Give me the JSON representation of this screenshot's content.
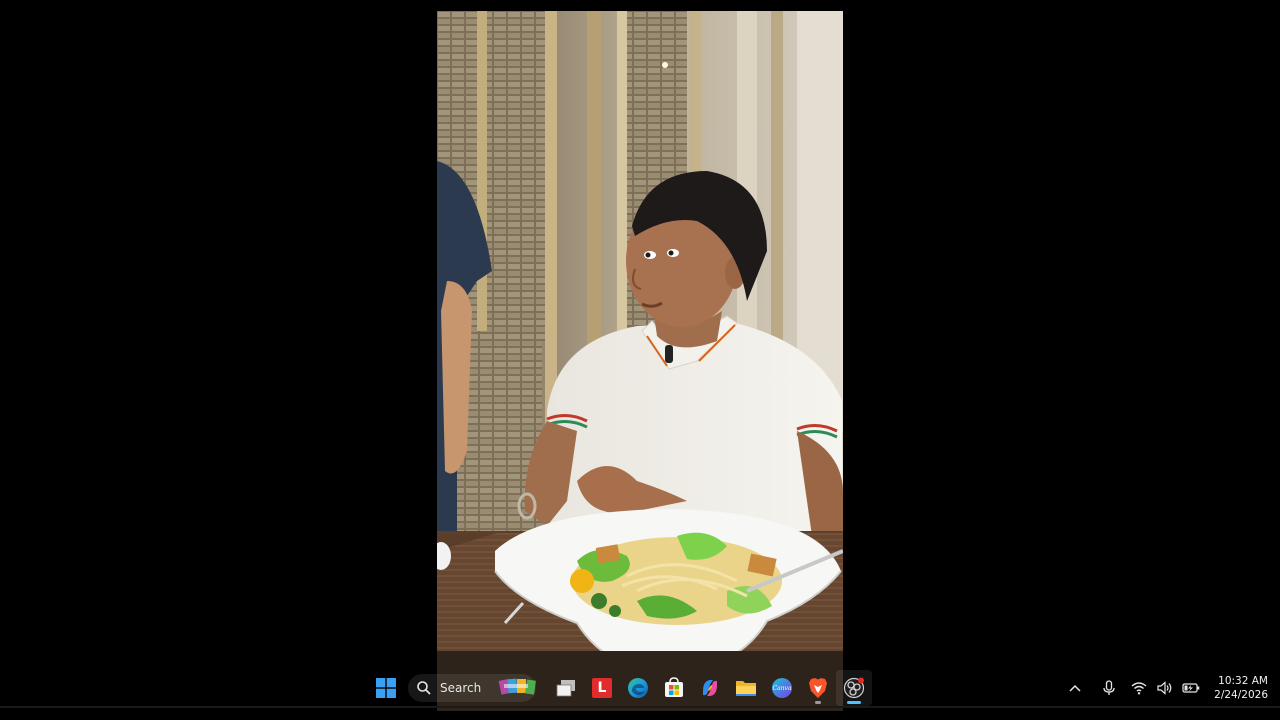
{
  "taskbar": {
    "search_label": "Search",
    "apps": [
      {
        "name": "task-view"
      },
      {
        "name": "lazada"
      },
      {
        "name": "edge"
      },
      {
        "name": "microsoft-store"
      },
      {
        "name": "copilot"
      },
      {
        "name": "file-explorer"
      },
      {
        "name": "canva"
      },
      {
        "name": "brave"
      },
      {
        "name": "obs"
      }
    ],
    "lazada_letter": "L",
    "canva_text": "Canva"
  },
  "tray": {
    "time": "10:32 AM",
    "date": "2/24/2026"
  },
  "colors": {
    "accent": "#4cc2ff",
    "windows_blue": "#3aa0f3",
    "lazada_red": "#e22b2b",
    "brave_orange": "#fb542b"
  }
}
